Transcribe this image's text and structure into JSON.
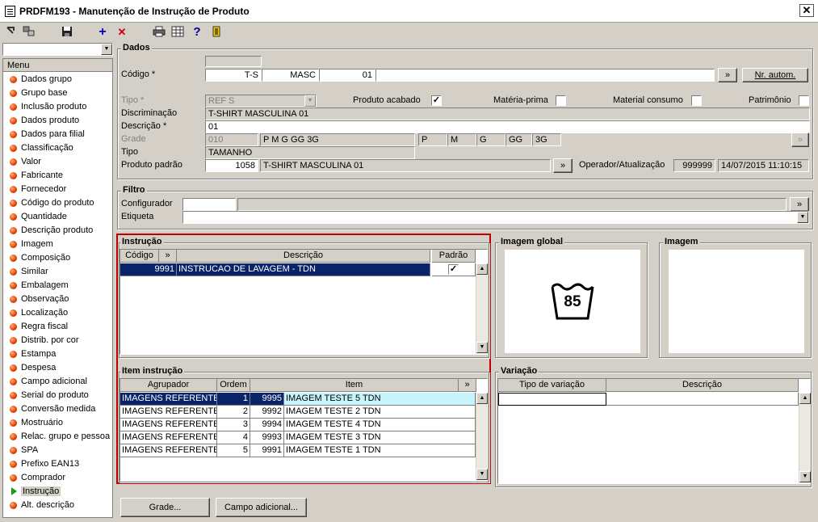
{
  "window": {
    "title": "PRDFM193 - Manutenção de Instrução de Produto",
    "close": "✕"
  },
  "toolbar": {
    "add": "+",
    "delete": "✕",
    "help": "?"
  },
  "sidebar": {
    "header": "Menu",
    "items": [
      {
        "label": "Dados grupo"
      },
      {
        "label": "Grupo base"
      },
      {
        "label": "Inclusão produto"
      },
      {
        "label": "Dados produto"
      },
      {
        "label": "Dados para filial"
      },
      {
        "label": "Classificação"
      },
      {
        "label": "Valor"
      },
      {
        "label": "Fabricante"
      },
      {
        "label": "Fornecedor"
      },
      {
        "label": "Código do produto"
      },
      {
        "label": "Quantidade"
      },
      {
        "label": "Descrição produto"
      },
      {
        "label": "Imagem"
      },
      {
        "label": "Composição"
      },
      {
        "label": "Similar"
      },
      {
        "label": "Embalagem"
      },
      {
        "label": "Observação"
      },
      {
        "label": "Localização"
      },
      {
        "label": "Regra fiscal"
      },
      {
        "label": "Distrib. por cor"
      },
      {
        "label": "Estampa"
      },
      {
        "label": "Despesa"
      },
      {
        "label": "Campo adicional"
      },
      {
        "label": "Serial do produto"
      },
      {
        "label": "Conversão medida"
      },
      {
        "label": "Mostruário"
      },
      {
        "label": "Relac. grupo e pessoa"
      },
      {
        "label": "SPA"
      },
      {
        "label": "Prefixo EAN13"
      },
      {
        "label": "Comprador"
      },
      {
        "label": "Instrução",
        "active": true
      },
      {
        "label": "Alt. descrição"
      }
    ]
  },
  "dados": {
    "title": "Dados",
    "codigo_label": "Código *",
    "codigo_1": "T-S",
    "codigo_2": "MASC",
    "codigo_3": "01",
    "more_btn": "»",
    "nr_autom_btn": "Nr. autom.",
    "tipo_label": "Tipo *",
    "tipo_value": "REF S",
    "produto_acabado": "Produto acabado",
    "materia_prima": "Matéria-prima",
    "material_consumo": "Material consumo",
    "patrimonio": "Patrimônio",
    "check_mark": "✓",
    "discriminacao_label": "Discriminação",
    "discriminacao_value": "T-SHIRT MASCULINA 01",
    "descricao_label": "Descrição *",
    "descricao_value": "01",
    "grade_label": "Grade",
    "grade_code": "010",
    "grade_desc": "P M G GG 3G",
    "grade_sizes": [
      "P",
      "M",
      "G",
      "GG",
      "3G"
    ],
    "tipo2_label": "Tipo",
    "tipo2_value": "TAMANHO",
    "produto_padrao_label": "Produto padrão",
    "produto_padrao_code": "1058",
    "produto_padrao_desc": "T-SHIRT MASCULINA 01",
    "operador_label": "Operador/Atualização",
    "operador_value": "999999",
    "atualizacao_value": "14/07/2015 11:10:15"
  },
  "filtro": {
    "title": "Filtro",
    "configurador_label": "Configurador",
    "etiqueta_label": "Etiqueta"
  },
  "instrucao": {
    "title": "Instrução",
    "columns": [
      "Código",
      "»",
      "Descrição",
      "Padrão"
    ],
    "rows": [
      {
        "codigo": "9991",
        "descricao": "INSTRUCAO DE LAVAGEM  - TDN",
        "padrao": "✓"
      }
    ]
  },
  "imagem_global": {
    "title": "Imagem global",
    "symbol_value": "85"
  },
  "imagem": {
    "title": "Imagem"
  },
  "item_instrucao": {
    "title": "Item instrução",
    "columns": [
      "Agrupador",
      "Ordem",
      "Item",
      "»"
    ],
    "rows": [
      {
        "agrupador": "IMAGENS REFERENTES",
        "ordem": "1",
        "codigo": "9995",
        "item": "IMAGEM TESTE 5 TDN"
      },
      {
        "agrupador": "IMAGENS REFERENTES",
        "ordem": "2",
        "codigo": "9992",
        "item": "IMAGEM TESTE 2 TDN"
      },
      {
        "agrupador": "IMAGENS REFERENTES",
        "ordem": "3",
        "codigo": "9994",
        "item": "IMAGEM TESTE 4 TDN"
      },
      {
        "agrupador": "IMAGENS REFERENTES",
        "ordem": "4",
        "codigo": "9993",
        "item": "IMAGEM TESTE 3 TDN"
      },
      {
        "agrupador": "IMAGENS REFERENTES",
        "ordem": "5",
        "codigo": "9991",
        "item": "IMAGEM TESTE 1 TDN"
      }
    ]
  },
  "variacao": {
    "title": "Variação",
    "columns": [
      "Tipo de variação",
      "Descrição"
    ]
  },
  "bottom": {
    "grade_btn": "Grade...",
    "campo_adicional_btn": "Campo adicional..."
  },
  "colors": {
    "selection": "#0a246a",
    "highlight": "#c00000",
    "face": "#d4d0c8"
  }
}
